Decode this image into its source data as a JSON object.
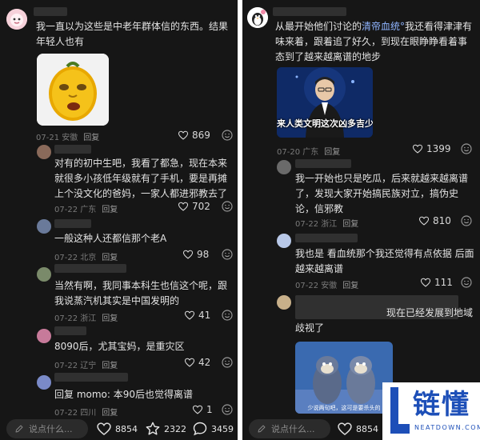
{
  "left": {
    "comments": [
      {
        "text": "我一直以为这些是中老年群体信的东西。结果年轻人也有",
        "date": "07-21",
        "location": "安徽",
        "reply": "回复",
        "likes": "869",
        "avatar_icon": "cartoon-avatar-icon",
        "image_icon": "yellow-face-sticker-icon"
      },
      {
        "text": "对有的初中生吧，我看了都急，现在本来就很多小孩低年级就有了手机，要是再摊上个没文化的爸妈，一家人都进邪教去了",
        "date": "07-22",
        "location": "广东",
        "reply": "回复",
        "likes": "702"
      },
      {
        "text": "一般这种人还都信那个老A",
        "date": "07-22",
        "location": "北京",
        "reply": "回复",
        "likes": "98"
      },
      {
        "text": "当然有啊，我同事本科生也信这个呢，跟我说蒸汽机其实是中国发明的",
        "date": "07-22",
        "location": "浙江",
        "reply": "回复",
        "likes": "41"
      },
      {
        "text": "8090后，尤其宝妈，是重灾区",
        "date": "07-22",
        "location": "辽宁",
        "reply": "回复",
        "likes": "42"
      },
      {
        "text": "回复 momo: 本90后也觉得离谱",
        "date": "07-22",
        "location": "四川",
        "reply": "回复",
        "likes": "1"
      }
    ],
    "bottom": {
      "placeholder": "说点什么...",
      "likes": "8854",
      "stars": "2322",
      "comments": "3459"
    }
  },
  "right": {
    "comments": [
      {
        "text_before": "从最开始他们讨论的",
        "tag": "清帝血统",
        "text_after": "我还看得津津有味来着，跟着追了好久，到现在眼睁睁看着事态到了越来越离谱的地步",
        "date": "07-20",
        "location": "广东",
        "reply": "回复",
        "likes": "1399",
        "image_caption": "来人类文明这次凶多吉少"
      },
      {
        "text": "我一开始也只是吃瓜，后来就越来越离谱了，发现大家开始搞民族对立，搞伪史论，信邪教",
        "date": "07-22",
        "location": "浙江",
        "reply": "回复",
        "likes": "810"
      },
      {
        "text": "我也是 看血统那个我还觉得有点依据 后面越来越离谱",
        "date": "07-22",
        "location": "安徽",
        "reply": "回复",
        "likes": "111"
      },
      {
        "text": "现在已经发展到地域歧视了",
        "image_caption": "少说两句吧，这可是要杀头的"
      }
    ],
    "bottom": {
      "placeholder": "说点什么...",
      "likes": "8854"
    }
  },
  "watermark": {
    "brand": "链懂",
    "url": "NEATDOWN.COM"
  },
  "colors": {
    "background": "#161616",
    "text": "#e3e3e3",
    "meta": "#7a7a7a",
    "tag": "#8fb4ff",
    "logo_blue": "#1d4fb8"
  }
}
